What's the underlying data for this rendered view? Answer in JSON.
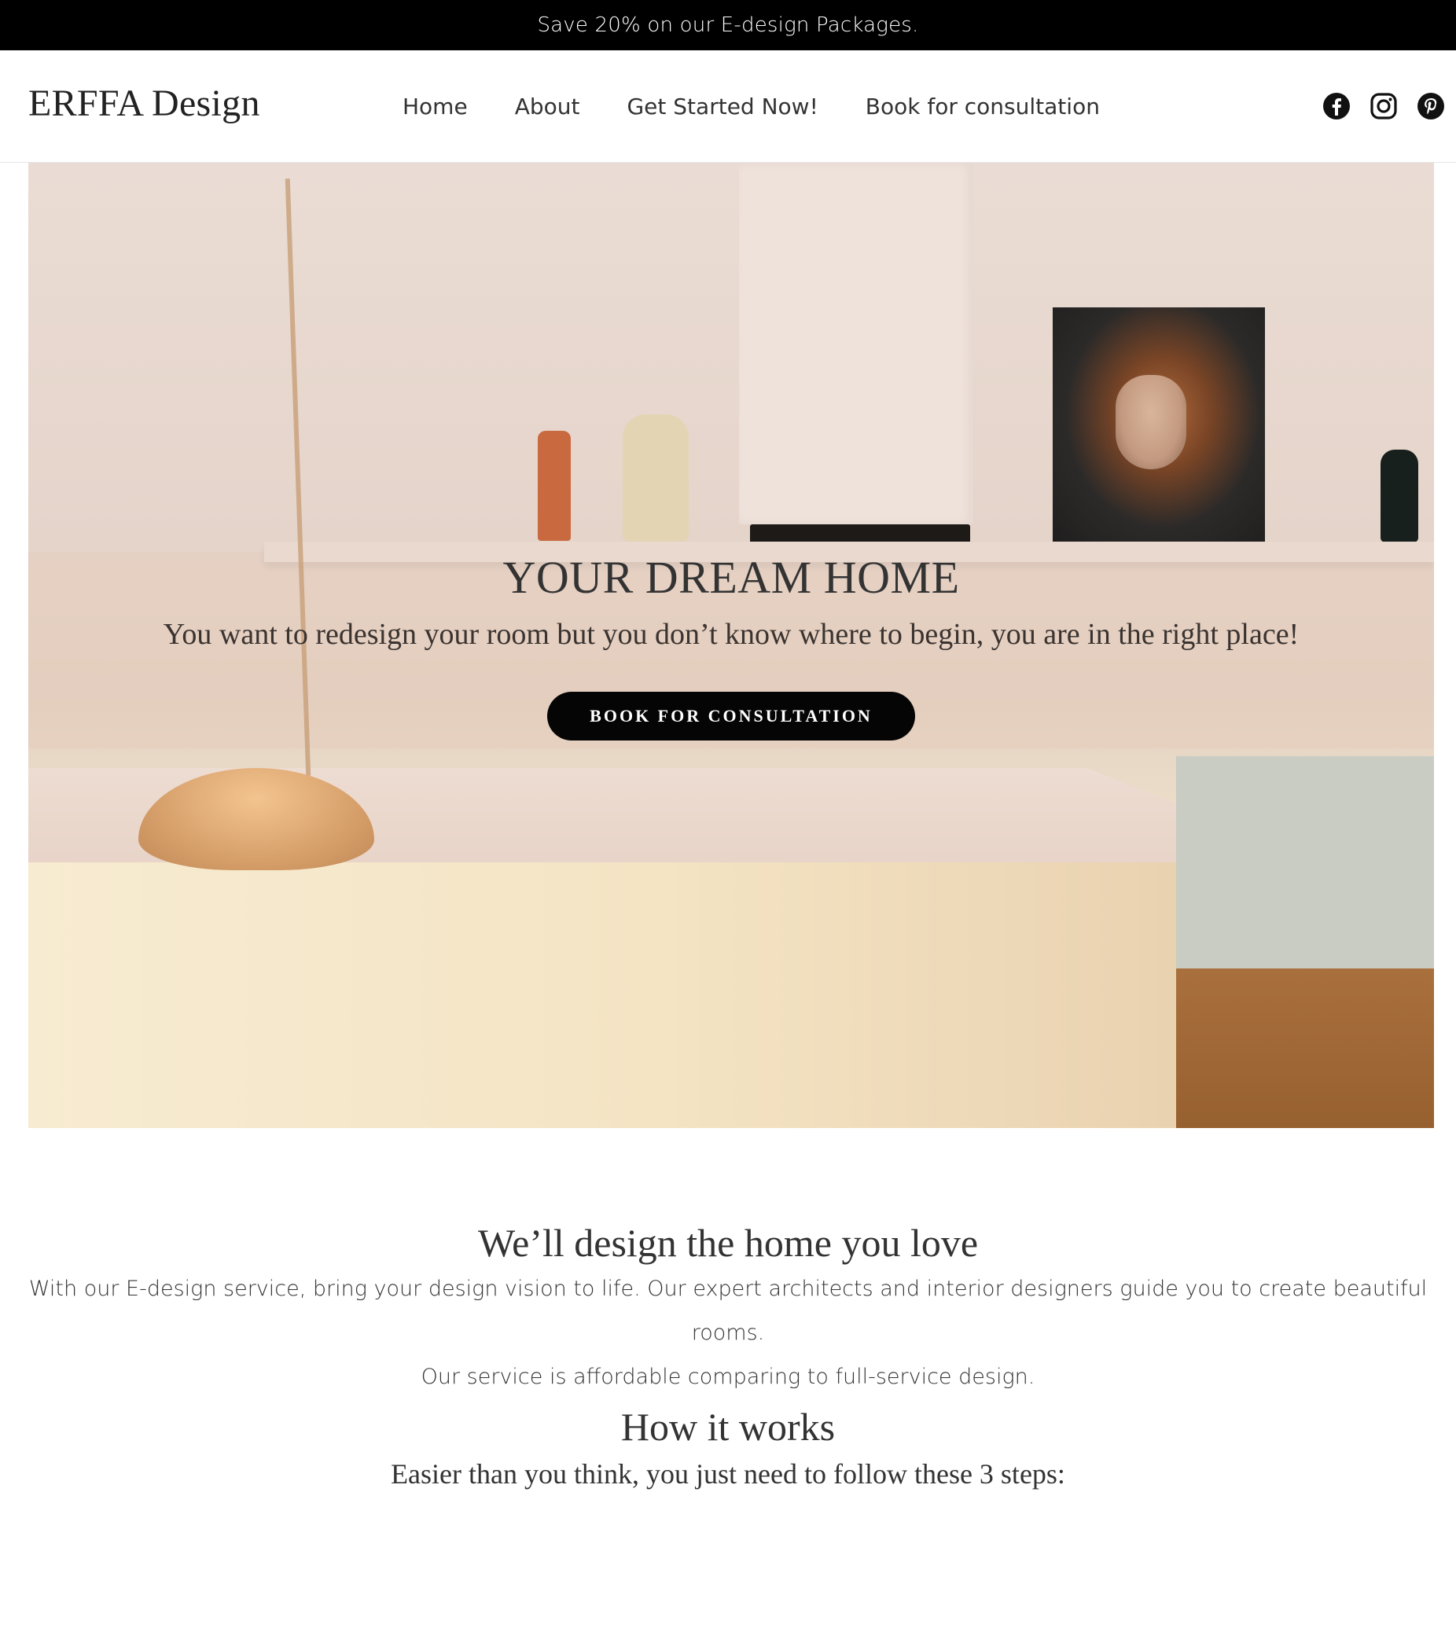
{
  "announcement": {
    "text": "Save 20% on our E-design Packages."
  },
  "header": {
    "logo": "ERFFA Design",
    "nav": [
      {
        "label": "Home"
      },
      {
        "label": "About"
      },
      {
        "label": "Get Started Now!"
      },
      {
        "label": "Book for consultation"
      }
    ],
    "social_icons": [
      "facebook-icon",
      "instagram-icon",
      "pinterest-icon"
    ]
  },
  "hero": {
    "title": "YOUR DREAM HOME",
    "subtitle": "You want to redesign your room but you don’t know where to begin, you are in the right place!",
    "button_label": "BOOK FOR CONSULTATION"
  },
  "intro": {
    "heading": "We’ll design the home you love",
    "line1": "With our E-design service, bring your design vision to life. Our expert architects and interior designers guide you to create beautiful rooms.",
    "line2": "Our service is affordable comparing to full-service design."
  },
  "how_it_works": {
    "heading": "How it works",
    "subheading": "Easier than you think, you just need to follow these 3 steps:"
  },
  "colors": {
    "announcement_bg": "#000000",
    "button_bg": "#050505",
    "text": "#333333"
  }
}
